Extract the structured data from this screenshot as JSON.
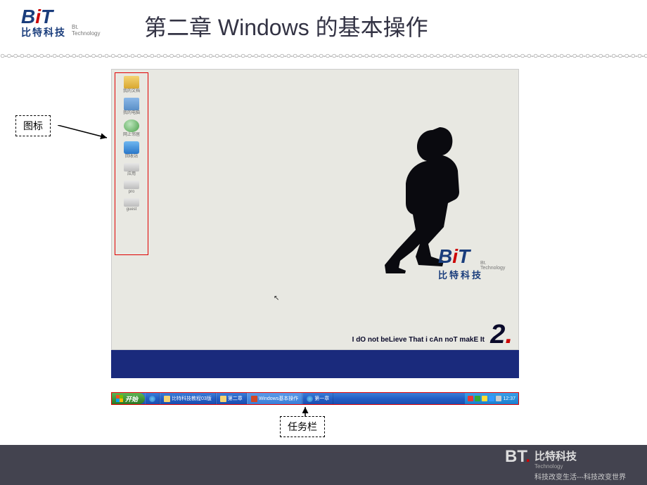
{
  "header": {
    "logo_text": "BiT",
    "logo_tech": "Bt. Technology",
    "logo_cn": "比特科技",
    "title": "第二章   Windows 的基本操作"
  },
  "labels": {
    "icons": "图标",
    "taskbar": "任务栏"
  },
  "desktop_icons": [
    {
      "name": "我的文档",
      "type": "folder"
    },
    {
      "name": "我的电脑",
      "type": "pc"
    },
    {
      "name": "网上邻居",
      "type": "net"
    },
    {
      "name": "回收站",
      "type": "ie"
    },
    {
      "name": "应用",
      "type": "drive"
    },
    {
      "name": "pro",
      "type": "drive"
    },
    {
      "name": "guest",
      "type": "drive"
    }
  ],
  "wallpaper": {
    "logo_text": "BiT",
    "logo_tech": "Bt. Technology",
    "logo_cn": "比特科技",
    "tagline": "I dO not beLieve That i cAn noT makE It",
    "number": "2"
  },
  "taskbar": {
    "start": "开始",
    "buttons": [
      {
        "label": "比特科技教程03版",
        "type": "folder"
      },
      {
        "label": "第二章",
        "type": "folder"
      },
      {
        "label": "Windows基本操作",
        "type": "ppt",
        "active": true
      },
      {
        "label": "第一章",
        "type": "ie"
      }
    ],
    "clock": "12:37"
  },
  "footer": {
    "bt": "BT",
    "tech": "Technology",
    "cn": "比特科技",
    "slogan": "科技改变生活---科技改变世界"
  }
}
